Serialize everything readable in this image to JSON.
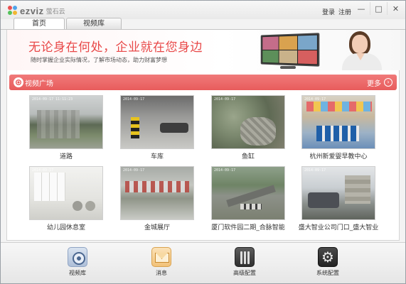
{
  "titlebar": {
    "brand": "ezviz",
    "brand_sub": "萤石云",
    "login": "登录",
    "register": "注册",
    "minimize_icon": "minimize-icon",
    "maximize_icon": "maximize-icon",
    "close_icon": "close-icon"
  },
  "tabs": [
    {
      "label": "首页",
      "active": true
    },
    {
      "label": "视频库",
      "active": false
    }
  ],
  "banner": {
    "slogan": "无论身在何处，企业就在您身边",
    "subtitle": "随时掌握企业实际情况，了解市场动态，助力财富梦想"
  },
  "section": {
    "title": "视频广场",
    "more": "更多",
    "accent": "#e85c5c"
  },
  "videos": [
    {
      "caption": "道路",
      "timestamp": "2014-09-17 11:11:23",
      "scene": "road"
    },
    {
      "caption": "车库",
      "timestamp": "2014-09-17",
      "scene": "garage"
    },
    {
      "caption": "鱼缸",
      "timestamp": "2014-09-17",
      "scene": "fish"
    },
    {
      "caption": "杭州新爱婴早教中心",
      "timestamp": "2014-09-17",
      "scene": "school"
    },
    {
      "caption": "幼儿园休息室",
      "timestamp": "2014-09-17",
      "scene": "kinder"
    },
    {
      "caption": "金城展厅",
      "timestamp": "2014-09-17",
      "scene": "hall"
    },
    {
      "caption": "厦门软件园二期_合脉智能",
      "timestamp": "2014-09-17",
      "scene": "park"
    },
    {
      "caption": "盛大智业公司门口_盛大智业",
      "timestamp": "2014-09-17",
      "scene": "office"
    }
  ],
  "toolbar": {
    "video_library": "视频库",
    "messages": "消息",
    "advanced_config": "高级配置",
    "system_config": "系统配置"
  }
}
